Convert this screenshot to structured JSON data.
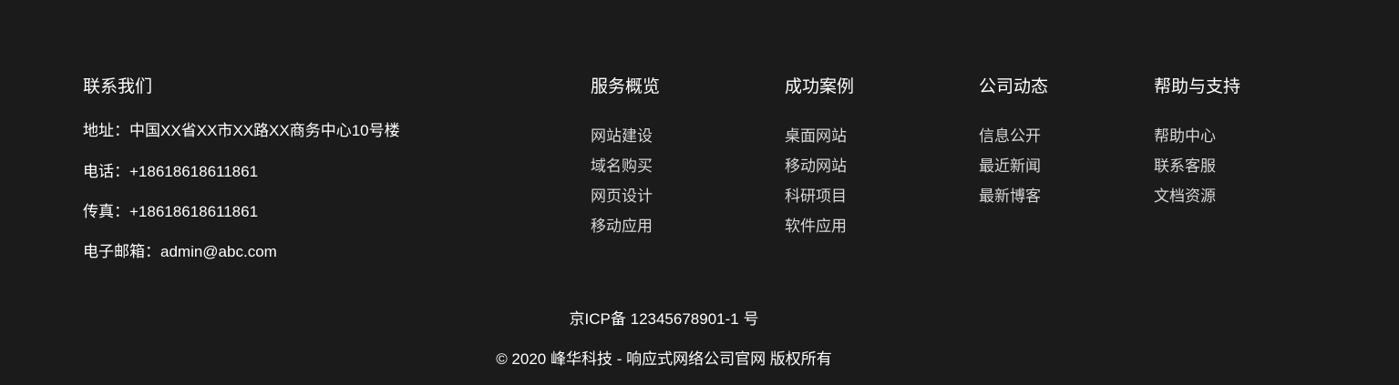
{
  "contact": {
    "title": "联系我们",
    "address_label": "地址：",
    "address_value": "中国XX省XX市XX路XX商务中心10号楼",
    "phone_label": "电话：",
    "phone_value": "+18618618611861",
    "fax_label": "传真：",
    "fax_value": "+18618618611861",
    "email_label": "电子邮箱：",
    "email_value": "admin@abc.com"
  },
  "columns": [
    {
      "title": "服务概览",
      "items": [
        "网站建设",
        "域名购买",
        "网页设计",
        "移动应用"
      ]
    },
    {
      "title": "成功案例",
      "items": [
        "桌面网站",
        "移动网站",
        "科研项目",
        "软件应用"
      ]
    },
    {
      "title": "公司动态",
      "items": [
        "信息公开",
        "最近新闻",
        "最新博客"
      ]
    },
    {
      "title": "帮助与支持",
      "items": [
        "帮助中心",
        "联系客服",
        "文档资源"
      ]
    }
  ],
  "footer_bottom": {
    "icp": "京ICP备 12345678901-1 号",
    "copyright": "© 2020 峰华科技 - 响应式网络公司官网 版权所有"
  },
  "colors": {
    "background": "#1b1b1b",
    "text": "#ffffff",
    "link": "#d8d8d8"
  }
}
